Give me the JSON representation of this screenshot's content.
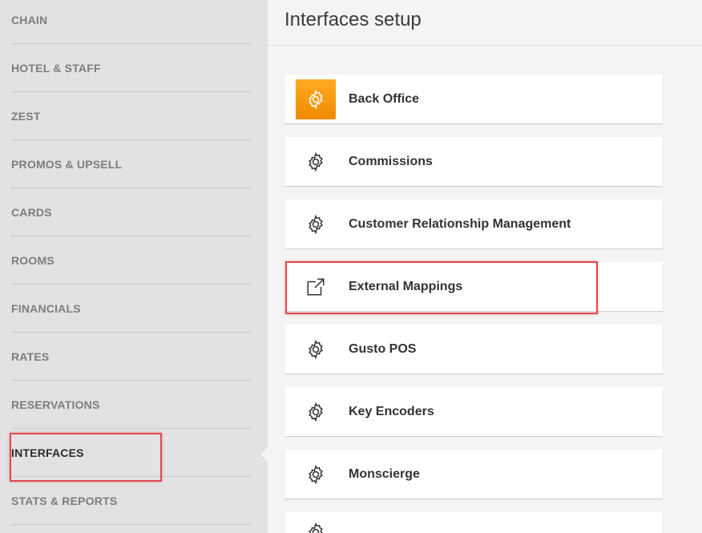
{
  "sidebar": {
    "items": [
      {
        "label": "CHAIN"
      },
      {
        "label": "HOTEL & STAFF"
      },
      {
        "label": "ZEST"
      },
      {
        "label": "PROMOS & UPSELL"
      },
      {
        "label": "CARDS"
      },
      {
        "label": "ROOMS"
      },
      {
        "label": "FINANCIALS"
      },
      {
        "label": "RATES"
      },
      {
        "label": "RESERVATIONS"
      },
      {
        "label": "INTERFACES"
      },
      {
        "label": "STATS & REPORTS"
      }
    ],
    "active": "INTERFACES"
  },
  "main": {
    "title": "Interfaces setup",
    "interfaces": [
      {
        "label": "Back Office",
        "icon": "gear-icon",
        "highlight": true
      },
      {
        "label": "Commissions",
        "icon": "gear-icon"
      },
      {
        "label": "Customer Relationship Management",
        "icon": "gear-icon"
      },
      {
        "label": "External Mappings",
        "icon": "external-link-icon"
      },
      {
        "label": "Gusto POS",
        "icon": "gear-icon"
      },
      {
        "label": "Key Encoders",
        "icon": "gear-icon"
      },
      {
        "label": "Monscierge",
        "icon": "gear-icon"
      },
      {
        "label": "",
        "icon": "gear-icon"
      }
    ]
  },
  "colors": {
    "sidebar_bg": "#e2e2e2",
    "accent_orange": "#f7931e",
    "highlight_red": "#e0474c"
  }
}
